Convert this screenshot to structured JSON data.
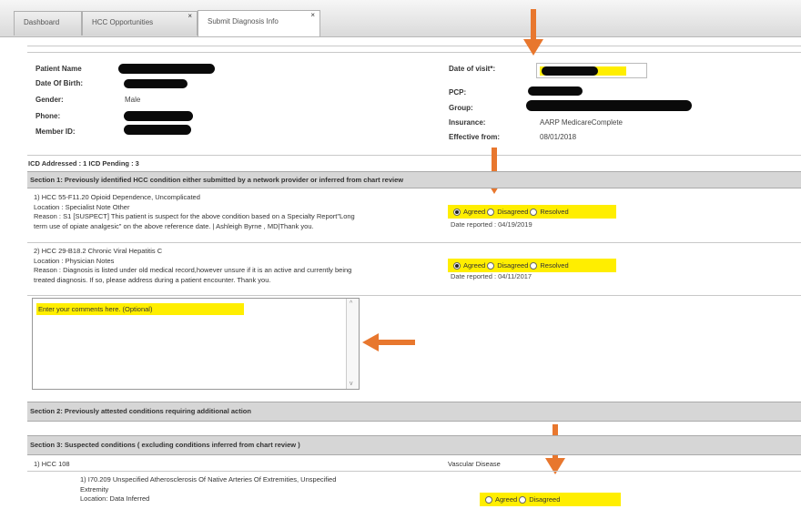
{
  "tabs": [
    {
      "label": "Dashboard",
      "close": ""
    },
    {
      "label": "HCC Opportunities",
      "close": "×"
    },
    {
      "label": "Submit Diagnosis Info",
      "close": "×"
    }
  ],
  "patient": {
    "name_label": "Patient Name",
    "dob_label": "Date Of Birth:",
    "gender_label": "Gender:",
    "gender_value": "Male",
    "phone_label": "Phone:",
    "member_label": "Member ID:",
    "visit_label": "Date of visit*:",
    "pcp_label": "PCP:",
    "group_label": "Group:",
    "insurance_label": "Insurance:",
    "insurance_value": "AARP MedicareComplete",
    "effective_label": "Effective from:",
    "effective_value": "08/01/2018"
  },
  "icd_summary": "ICD Addressed : 1 ICD Pending : 3",
  "section1": {
    "title": "Section 1: Previously identified HCC condition either submitted by a network provider or inferred from chart review",
    "items": [
      {
        "title": "1) HCC 55-F11.20 Opioid Dependence, Uncomplicated",
        "location": "Location : Specialist Note Other",
        "reason1": "Reason : S1 [SUSPECT] This patient is suspect for the above condition based on a Specialty Report\"Long",
        "reason2": "term use of opiate analgesic\" on the above reference date. | Ashleigh Byrne , MD|Thank you.",
        "options": [
          "Agreed",
          "Disagreed",
          "Resolved"
        ],
        "selected": "Agreed",
        "date_reported": "Date reported : 04/19/2019"
      },
      {
        "title": "2) HCC 29-B18.2 Chronic Viral Hepatitis C",
        "location": "Location : Physician Notes",
        "reason1": "Reason : Diagnosis is listed under old medical record,however unsure if it is an active and currently being",
        "reason2": "treated diagnosis. If so, please address during a patient encounter. Thank you.",
        "options": [
          "Agreed",
          "Disagreed",
          "Resolved"
        ],
        "selected": "Agreed",
        "date_reported": "Date reported : 04/11/2017"
      }
    ],
    "comment_placeholder": "Enter your comments here. (Optional)"
  },
  "section2": {
    "title": "Section 2: Previously attested conditions requiring additional action"
  },
  "section3": {
    "title": "Section 3: Suspected conditions ( excluding conditions inferred from chart review )",
    "row_left": "1) HCC 108",
    "row_right": "Vascular Disease",
    "detail1": "1) I70.209   Unspecified Atherosclerosis Of Native Arteries Of Extremities, Unspecified",
    "detail2": "Extremity",
    "detail3": "Location: Data Inferred",
    "options": [
      "Agreed",
      "Disagreed"
    ]
  },
  "colors": {
    "highlight": "#ffee00",
    "arrow": "#e8772e",
    "section_bg": "#d6d6d6"
  }
}
